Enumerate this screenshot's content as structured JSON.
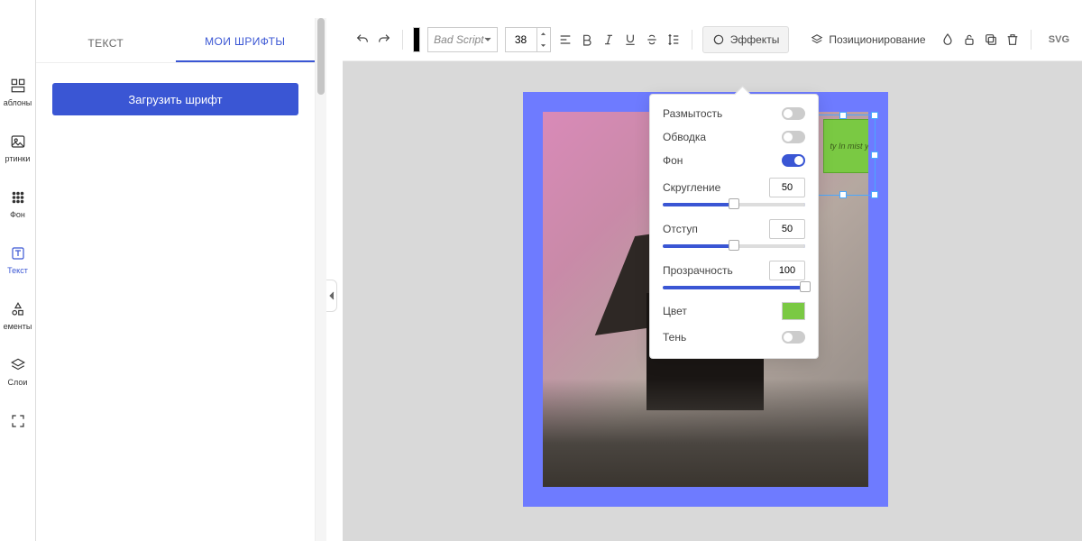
{
  "rail": {
    "items": [
      {
        "key": "templates",
        "label": "аблоны"
      },
      {
        "key": "images",
        "label": "ртинки"
      },
      {
        "key": "bg",
        "label": "Фон"
      },
      {
        "key": "text",
        "label": "Текст"
      },
      {
        "key": "elements",
        "label": "ементы"
      },
      {
        "key": "layers",
        "label": "Слои"
      },
      {
        "key": "fullscreen",
        "label": ""
      }
    ],
    "active": "text"
  },
  "panel": {
    "tabs": {
      "text": "ТЕКСТ",
      "myfonts": "МОИ ШРИФТЫ",
      "active": "myfonts"
    },
    "upload_label": "Загрузить шрифт"
  },
  "toolbar": {
    "font_name": "Bad Script",
    "font_size": "38",
    "effects_label": "Эффекты",
    "position_label": "Позиционирование",
    "svg_label": "SVG"
  },
  "effects": {
    "blur": {
      "label": "Размытость",
      "on": false
    },
    "stroke": {
      "label": "Обводка",
      "on": false
    },
    "background": {
      "label": "Фон",
      "on": true
    },
    "radius": {
      "label": "Скругление",
      "value": "50",
      "pct": 50
    },
    "padding": {
      "label": "Отступ",
      "value": "50",
      "pct": 50
    },
    "opacity": {
      "label": "Прозрачность",
      "value": "100",
      "pct": 100
    },
    "color": {
      "label": "Цвет",
      "hex": "#7ac943"
    },
    "shadow": {
      "label": "Тень",
      "on": false
    }
  },
  "canvas": {
    "text_content": "ty In\nmist\ny"
  }
}
